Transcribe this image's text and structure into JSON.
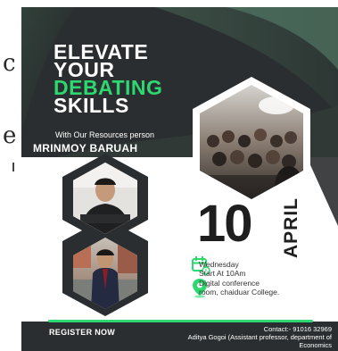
{
  "edge": {
    "chars": [
      "c",
      "e"
    ]
  },
  "poster": {
    "headline": {
      "line1": "ELEVATE",
      "line2": "YOUR",
      "line3": "DEBATING",
      "line4": "SKILLS"
    },
    "subtitle": "With Our Resources person",
    "speaker": "MRINMOY BARUAH",
    "date": {
      "day": "10",
      "month": "APRIL"
    },
    "schedule": {
      "line1": "Wednesday",
      "line2": "Start At 10Am"
    },
    "venue": {
      "line1": "Digital conference",
      "line2": "room, chaiduar College."
    },
    "footer": {
      "register_label": "REGISTER NOW",
      "contact_line1": "Contact:- 91016 32969",
      "contact_line2": "Aditya Gogoi (Assistant professor, department of",
      "contact_line3": "Economics"
    }
  },
  "colors": {
    "dark": "#2b2e30",
    "accent_green": "#2ed870",
    "text_dark": "#1e1e1e"
  },
  "icons": [
    "calendar-icon",
    "location-pin-icon"
  ]
}
